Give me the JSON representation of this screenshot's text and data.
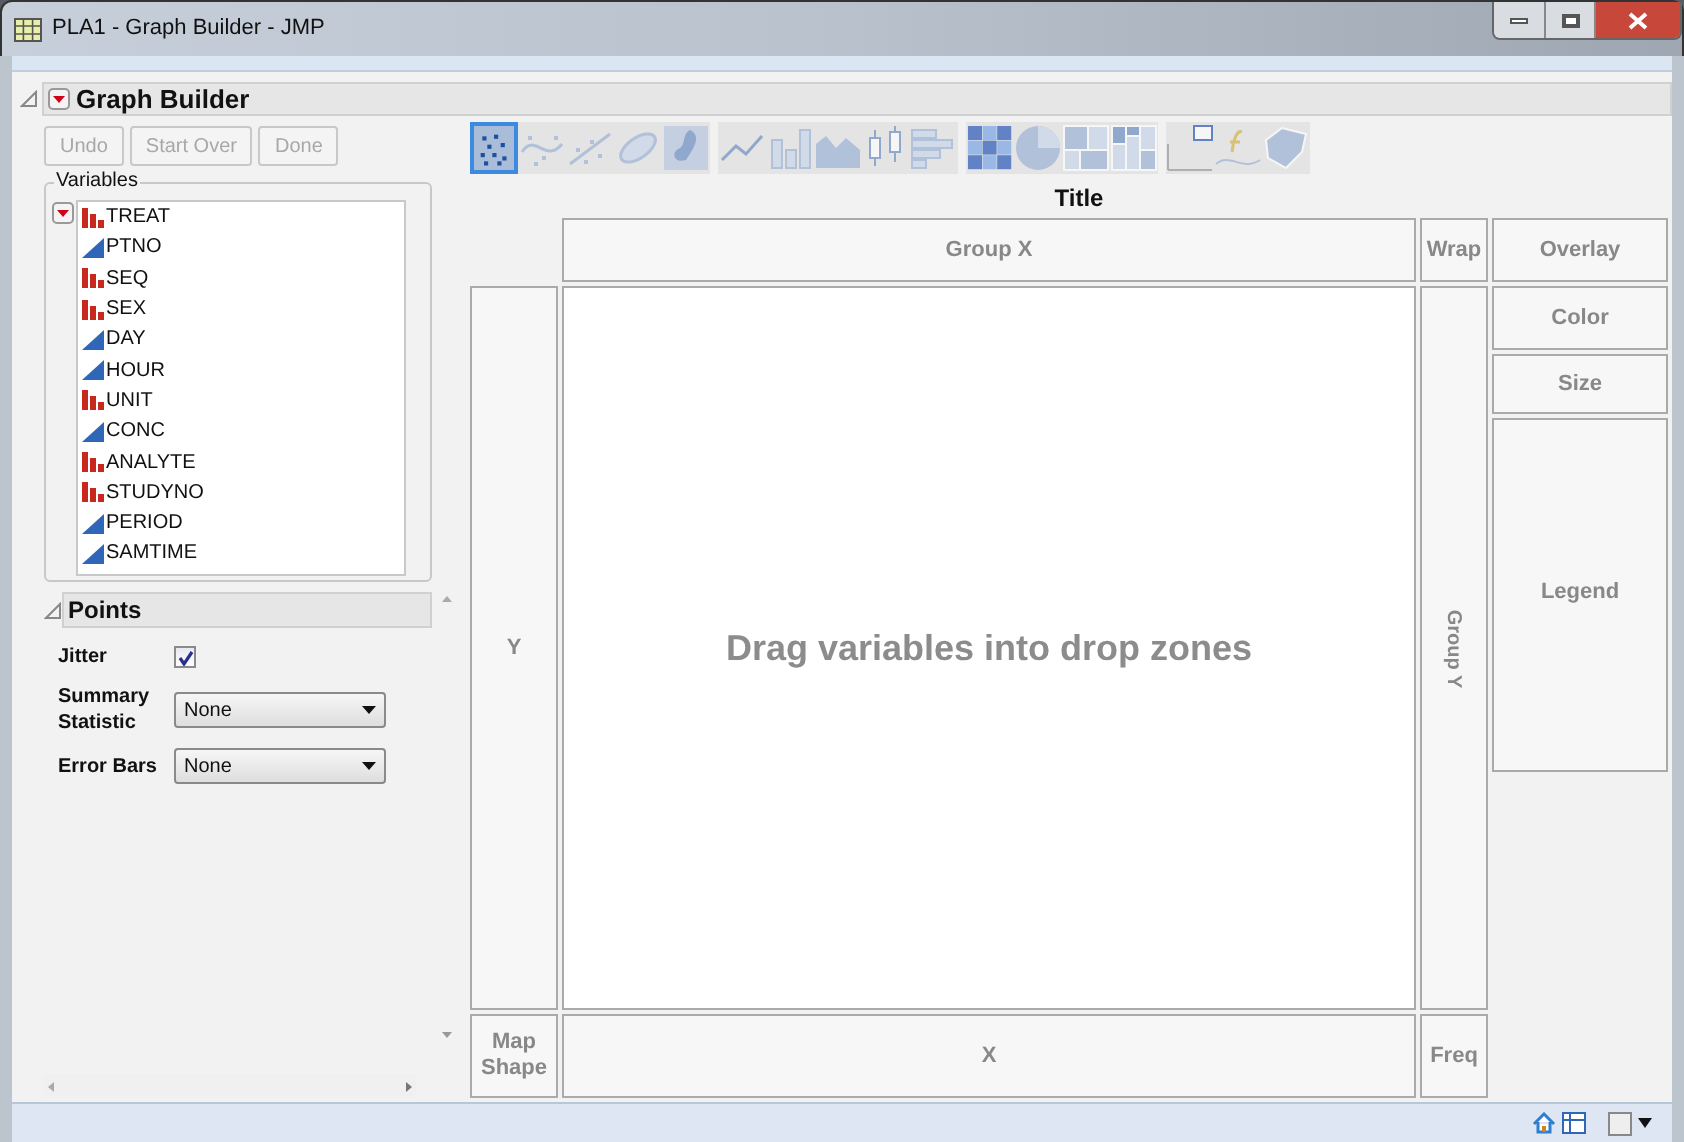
{
  "window": {
    "title": "PLA1 - Graph Builder - JMP"
  },
  "report": {
    "title": "Graph Builder",
    "expanded": true
  },
  "buttons": [
    {
      "label": "Undo",
      "disabled": true
    },
    {
      "label": "Start Over",
      "disabled": true
    },
    {
      "label": "Done",
      "disabled": true
    }
  ],
  "variables": {
    "label": "Variables",
    "items": [
      {
        "name": "TREAT",
        "kind": "nominal"
      },
      {
        "name": "PTNO",
        "kind": "continuous"
      },
      {
        "name": "SEQ",
        "kind": "nominal"
      },
      {
        "name": "SEX",
        "kind": "nominal"
      },
      {
        "name": "DAY",
        "kind": "continuous"
      },
      {
        "name": "HOUR",
        "kind": "continuous"
      },
      {
        "name": "UNIT",
        "kind": "nominal"
      },
      {
        "name": "CONC",
        "kind": "continuous"
      },
      {
        "name": "ANALYTE",
        "kind": "nominal"
      },
      {
        "name": "STUDYNO",
        "kind": "nominal"
      },
      {
        "name": "PERIOD",
        "kind": "continuous"
      },
      {
        "name": "SAMTIME",
        "kind": "continuous"
      }
    ]
  },
  "points": {
    "title": "Points",
    "expanded": true,
    "jitter": {
      "label": "Jitter",
      "checked": true
    },
    "fields": [
      {
        "label": "Summary Statistic",
        "value": "None"
      },
      {
        "label": "Error Bars",
        "value": "None"
      }
    ]
  },
  "graph_types": [
    [
      {
        "kind": "points",
        "selected": true
      },
      {
        "kind": "smoother",
        "selected": false
      },
      {
        "kind": "fit",
        "selected": false
      },
      {
        "kind": "ellipse",
        "selected": false
      },
      {
        "kind": "contour",
        "selected": false
      }
    ],
    [
      {
        "kind": "line",
        "selected": false
      },
      {
        "kind": "bar",
        "selected": false
      },
      {
        "kind": "area",
        "selected": false
      },
      {
        "kind": "boxplot",
        "selected": false
      },
      {
        "kind": "histogram",
        "selected": false
      }
    ],
    [
      {
        "kind": "heatmap",
        "selected": false
      },
      {
        "kind": "pie",
        "selected": false
      },
      {
        "kind": "treemap",
        "selected": false
      },
      {
        "kind": "mosaic",
        "selected": false
      }
    ],
    [
      {
        "kind": "caption",
        "selected": false
      },
      {
        "kind": "formula",
        "selected": false
      },
      {
        "kind": "map",
        "selected": false
      }
    ]
  ],
  "canvas": {
    "title": "Title",
    "group_x": "Group X",
    "wrap": "Wrap",
    "overlay": "Overlay",
    "color_zone": "Color",
    "size": "Size",
    "legend": "Legend",
    "y": "Y",
    "group_y": "Group Y",
    "hint": "Drag variables into drop zones",
    "map_shape": "Map Shape",
    "x": "X",
    "freq": "Freq"
  }
}
